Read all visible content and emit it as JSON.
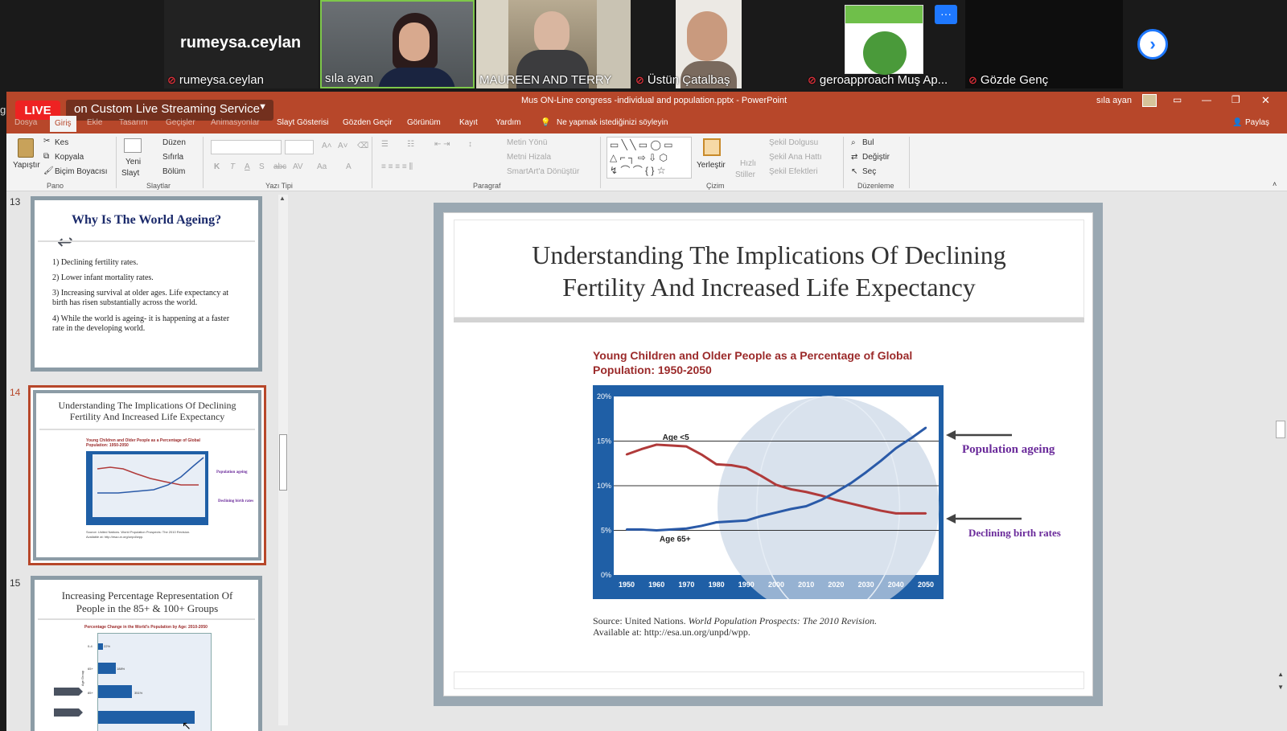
{
  "meeting": {
    "participants": [
      {
        "name": "rumeysa.ceylan",
        "muted": true,
        "video": false
      },
      {
        "name": "sıla ayan",
        "muted": false,
        "video": true
      },
      {
        "name": "MAUREEN AND TERRY",
        "muted": false,
        "video": true
      },
      {
        "name": "Üstün Çatalbaş",
        "muted": true,
        "video": true
      },
      {
        "name": "geroapproach Muş Ap...",
        "muted": true,
        "video": true
      },
      {
        "name": "Gözde Genç",
        "muted": true,
        "video": false
      }
    ],
    "big_name": "rumeysa.ceylan",
    "more_button": "···",
    "next_button": "›",
    "edge_glyph": "g"
  },
  "window": {
    "live_label": "LIVE",
    "stream_service": "on Custom Live Streaming Service",
    "document_title": "Mus ON-Line congress -individual and population.pptx  -  PowerPoint",
    "user_name": "sıla ayan",
    "share_label": "Paylaş",
    "controls": [
      "—",
      "❐",
      "✕"
    ]
  },
  "ribbon": {
    "tabs": [
      "Dosya",
      "Giriş",
      "Ekle",
      "Tasarım",
      "Geçişler",
      "Animasyonlar",
      "Slayt Gösterisi",
      "Gözden Geçir",
      "Görünüm",
      "Kayıt",
      "Yardım"
    ],
    "active_tab": "Giriş",
    "tell_me": "Ne yapmak istediğinizi söyleyin",
    "groups": {
      "pano": {
        "label": "Pano",
        "paste": "Yapıştır",
        "cut": "Kes",
        "copy": "Kopyala",
        "format_painter": "Biçim Boyacısı"
      },
      "slaytlar": {
        "label": "Slaytlar",
        "new_slide": "Yeni",
        "new_slide2": "Slayt",
        "layout": "Düzen",
        "reset": "Sıfırla",
        "section": "Bölüm"
      },
      "yazi_tipi": {
        "label": "Yazı Tipi",
        "format_buttons": [
          "K",
          "T",
          "A",
          "S",
          "abc",
          "AV",
          "Aa",
          "A"
        ]
      },
      "paragraf": {
        "label": "Paragraf",
        "text_direction": "Metin Yönü",
        "align_text": "Metni Hizala",
        "smartart": "SmartArt'a Dönüştür"
      },
      "cizim": {
        "label": "Çizim",
        "arrange": "Yerleştir",
        "quick_styles": "Hızlı",
        "quick_styles2": "Stiller",
        "shape_fill": "Şekil Dolgusu",
        "shape_outline": "Şekil Ana Hattı",
        "shape_effects": "Şekil Efektleri"
      },
      "duzenleme": {
        "label": "Düzenleme",
        "find": "Bul",
        "replace": "Değiştir",
        "select": "Seç"
      }
    }
  },
  "thumbnails": [
    {
      "number": "13",
      "title": "Why Is The World Ageing?",
      "items": [
        "1) Declining fertility rates.",
        "2) Lower infant mortality rates.",
        "3) Increasing survival at older ages. Life expectancy at birth has risen substantially across the world.",
        "4) While the world is ageing- it is happening at a faster rate in the developing world."
      ]
    },
    {
      "number": "14",
      "title": "Understanding The Implications Of Declining Fertility And Increased Life Expectancy",
      "chart_title": "Young Children and Older People as a Percentage of Global Population: 1950-2050",
      "annot1": "Population ageing",
      "annot2": "Declining birth rates",
      "source": "Source: United Nations. World Population Prospects: The 2010 Revision.",
      "source2": "Available at: http://esa.un.org/unpd/wpp."
    },
    {
      "number": "15",
      "title": "Increasing Percentage Representation Of People in the 85+ & 100+ Groups",
      "chart_title": "Percentage Change in the World's Population by Age: 2010-2050",
      "bars": [
        {
          "label": "0-4",
          "value": "22%"
        },
        {
          "label": "65+",
          "value": "188%"
        },
        {
          "label": "85+",
          "value": "351%"
        }
      ],
      "axis_label": "Age Group"
    }
  ],
  "slide": {
    "title_line1": "Understanding The Implications Of Declining",
    "title_line2": "Fertility And Increased Life Expectancy",
    "chart_title_line1": "Young Children and Older People as a Percentage of Global",
    "chart_title_line2": "Population: 1950-2050",
    "annotation_ageing": "Population ageing",
    "annotation_birth": "Declining birth rates",
    "source_prefix": "Source: United Nations.",
    "source_italic": "World Population Prospects: The 2010 Revision.",
    "source_line2": "Available at: http://esa.un.org/unpd/wpp."
  },
  "chart_data": {
    "type": "line",
    "title": "Young Children and Older People as a Percentage of Global Population: 1950-2050",
    "x": [
      1950,
      1955,
      1960,
      1965,
      1970,
      1975,
      1980,
      1985,
      1990,
      1995,
      2000,
      2005,
      2010,
      2015,
      2020,
      2025,
      2030,
      2035,
      2040,
      2045,
      2050
    ],
    "x_ticks": [
      "1950",
      "1960",
      "1970",
      "1980",
      "1990",
      "2000",
      "2010",
      "2020",
      "2030",
      "2040",
      "2050"
    ],
    "y_ticks": [
      "0%",
      "5%",
      "10%",
      "15%",
      "20%"
    ],
    "ylim": [
      0,
      20
    ],
    "series": [
      {
        "name": "Age <5",
        "color": "#b03a3a",
        "values": [
          13.5,
          14.1,
          14.6,
          14.5,
          14.4,
          13.5,
          12.4,
          12.3,
          12.0,
          11.1,
          10.1,
          9.6,
          9.3,
          8.9,
          8.4,
          8.0,
          7.6,
          7.2,
          6.9,
          6.9,
          6.9
        ]
      },
      {
        "name": "Age 65+",
        "color": "#2a5aa8",
        "values": [
          5.1,
          5.1,
          5.0,
          5.1,
          5.2,
          5.5,
          5.9,
          6.0,
          6.1,
          6.6,
          7.0,
          7.4,
          7.7,
          8.4,
          9.3,
          10.3,
          11.5,
          12.8,
          14.2,
          15.3,
          16.5
        ]
      }
    ],
    "grid": true,
    "colors": {
      "plot_frame": "#1f5fa6",
      "plot_bg": "#ffffff",
      "tick_text": "#ffffff"
    }
  }
}
